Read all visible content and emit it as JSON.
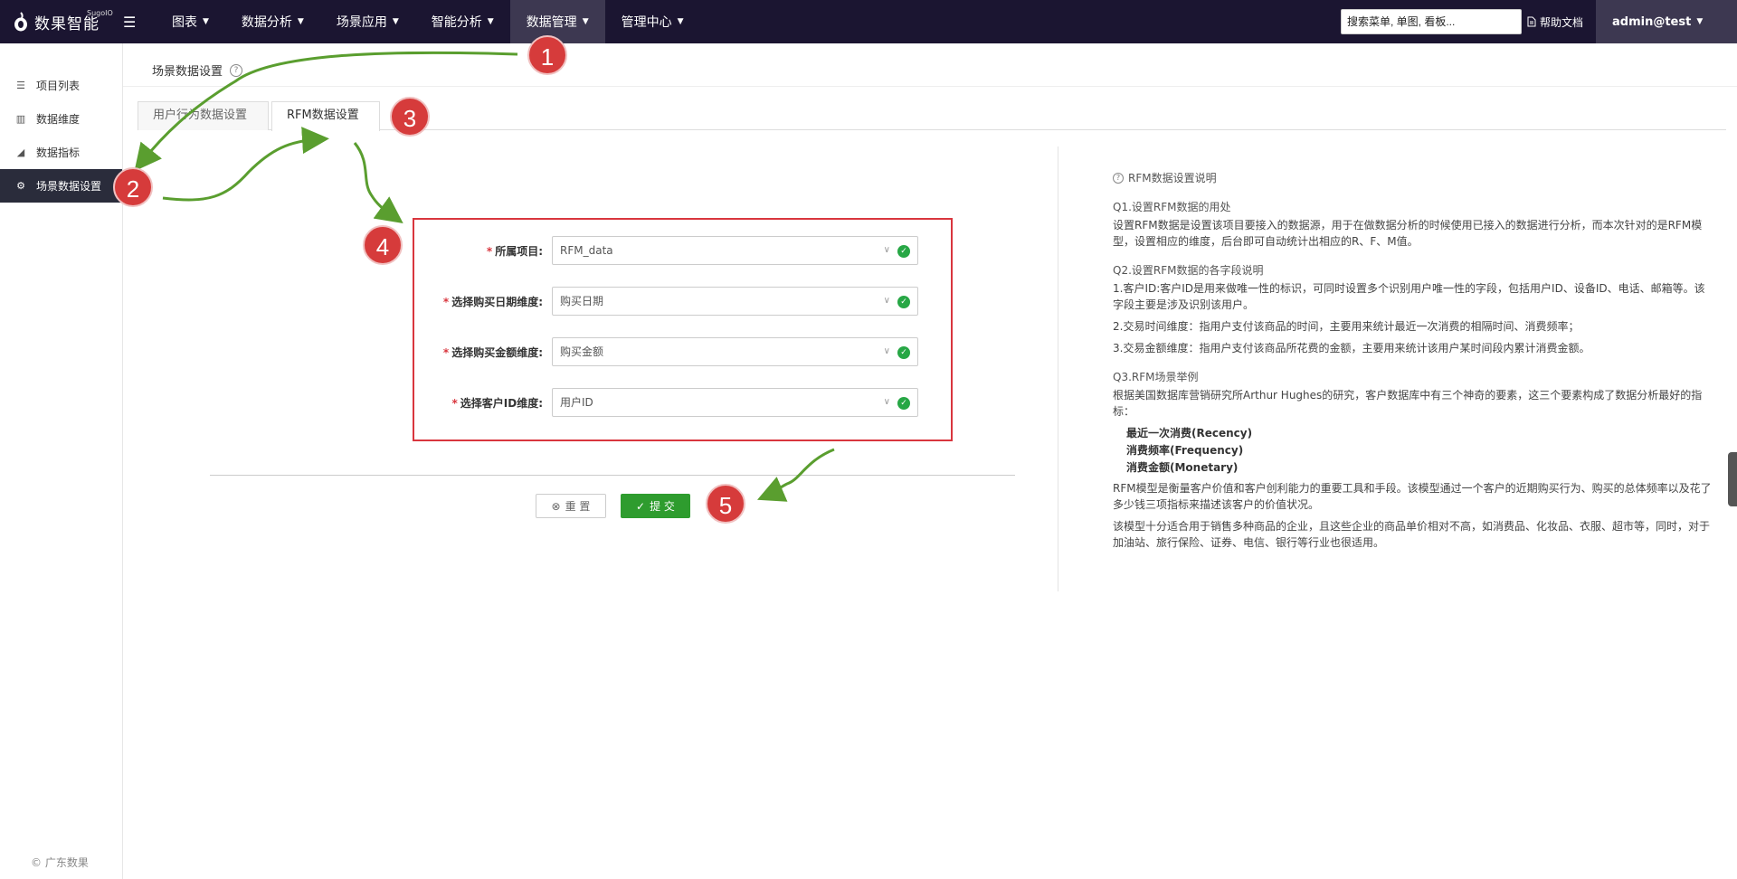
{
  "topbar": {
    "logo_text": "数果智能",
    "logo_sup": "SugoIO",
    "nav": [
      {
        "label": "图表"
      },
      {
        "label": "数据分析"
      },
      {
        "label": "场景应用"
      },
      {
        "label": "智能分析"
      },
      {
        "label": "数据管理"
      },
      {
        "label": "管理中心"
      }
    ],
    "search_placeholder": "搜索菜单, 单图, 看板...",
    "help_label": "帮助文档",
    "user": "admin@test"
  },
  "sidebar": {
    "items": [
      {
        "label": "项目列表"
      },
      {
        "label": "数据维度"
      },
      {
        "label": "数据指标"
      },
      {
        "label": "场景数据设置"
      }
    ],
    "copyright": "© 广东数果"
  },
  "page": {
    "title": "场景数据设置",
    "tabs": [
      {
        "label": "用户行为数据设置"
      },
      {
        "label": "RFM数据设置"
      }
    ]
  },
  "form": {
    "fields": [
      {
        "label": "所属项目:",
        "value": "RFM_data"
      },
      {
        "label": "选择购买日期维度:",
        "value": "购买日期"
      },
      {
        "label": "选择购买金额维度:",
        "value": "购买金额"
      },
      {
        "label": "选择客户ID维度:",
        "value": "用户ID"
      }
    ],
    "reset_label": "重 置",
    "submit_label": "提 交"
  },
  "help": {
    "title": "RFM数据设置说明",
    "q1": "Q1.设置RFM数据的用处",
    "q1_text": "设置RFM数据是设置该项目要接入的数据源，用于在做数据分析的时候使用已接入的数据进行分析，而本次针对的是RFM模型，设置相应的维度，后台即可自动统计出相应的R、F、M值。",
    "q2": "Q2.设置RFM数据的各字段说明",
    "q2_p1": "1.客户ID:客户ID是用来做唯一性的标识，可同时设置多个识别用户唯一性的字段，包括用户ID、设备ID、电话、邮箱等。该字段主要是涉及识别该用户。",
    "q2_p2": "2.交易时间维度：指用户支付该商品的时间，主要用来统计最近一次消费的相隔时间、消费频率；",
    "q2_p3": "3.交易金额维度：指用户支付该商品所花费的金额，主要用来统计该用户某时间段内累计消费金额。",
    "q3": "Q3.RFM场景举例",
    "q3_text": "根据美国数据库营销研究所Arthur Hughes的研究，客户数据库中有三个神奇的要素，这三个要素构成了数据分析最好的指标：",
    "metrics": [
      "最近一次消费(Recency)",
      "消费频率(Frequency)",
      "消费金额(Monetary)"
    ],
    "p_model": "RFM模型是衡量客户价值和客户创利能力的重要工具和手段。该模型通过一个客户的近期购买行为、购买的总体频率以及花了多少钱三项指标来描述该客户的价值状况。",
    "p_usage": "该模型十分适合用于销售多种商品的企业，且这些企业的商品单价相对不高，如消费品、化妆品、衣服、超市等，同时，对于加油站、旅行保险、证券、电信、银行等行业也很适用。"
  },
  "annotations": [
    "1",
    "2",
    "3",
    "4",
    "5"
  ],
  "colors": {
    "topbar": "#1b1531",
    "highlight_box": "#d9363e",
    "badge": "#d63b3b",
    "arrow": "#5a9e2f",
    "submit": "#2e9c2e"
  }
}
